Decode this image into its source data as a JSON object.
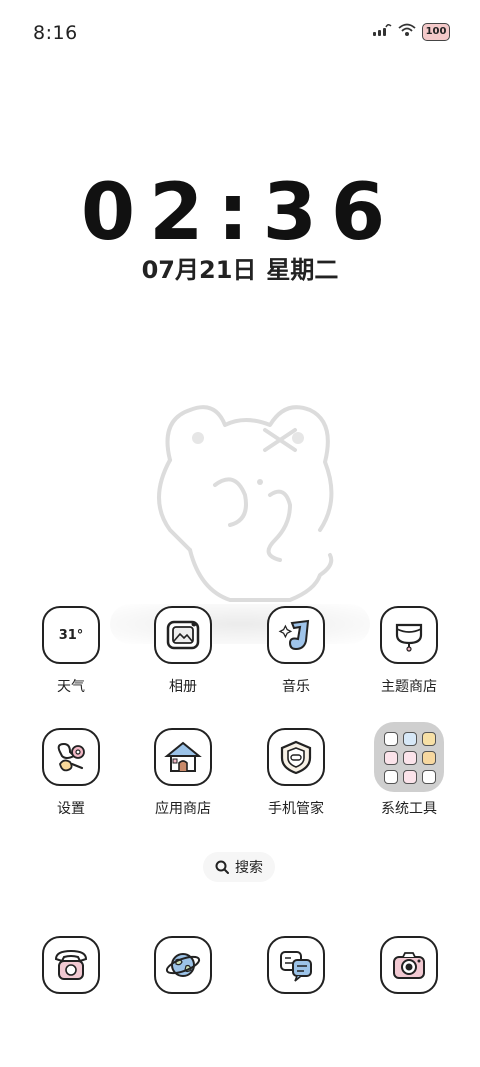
{
  "status_bar": {
    "time": "8:16",
    "battery": "100",
    "icons": [
      "signal-icon",
      "wifi-icon",
      "battery-icon"
    ]
  },
  "clock": {
    "time": "02:36",
    "date": "07月21日",
    "weekday": "星期二"
  },
  "apps_row1": [
    {
      "label": "天气",
      "icon": "weather-icon",
      "icon_text": "31°"
    },
    {
      "label": "相册",
      "icon": "gallery-icon"
    },
    {
      "label": "音乐",
      "icon": "music-icon"
    },
    {
      "label": "主题商店",
      "icon": "theme-store-icon"
    }
  ],
  "apps_row2": [
    {
      "label": "设置",
      "icon": "settings-icon"
    },
    {
      "label": "应用商店",
      "icon": "app-store-icon"
    },
    {
      "label": "手机管家",
      "icon": "phone-manager-icon"
    },
    {
      "label": "系统工具",
      "icon": "folder-icon"
    }
  ],
  "search": {
    "label": "搜索"
  },
  "dock": [
    {
      "icon": "phone-icon"
    },
    {
      "icon": "browser-icon"
    },
    {
      "icon": "messages-icon"
    },
    {
      "icon": "camera-icon"
    }
  ],
  "colors": {
    "background": "#ffffff",
    "text": "#222222",
    "folder_bg": "#cfcfcf",
    "battery_fill": "#f4c9c9"
  }
}
